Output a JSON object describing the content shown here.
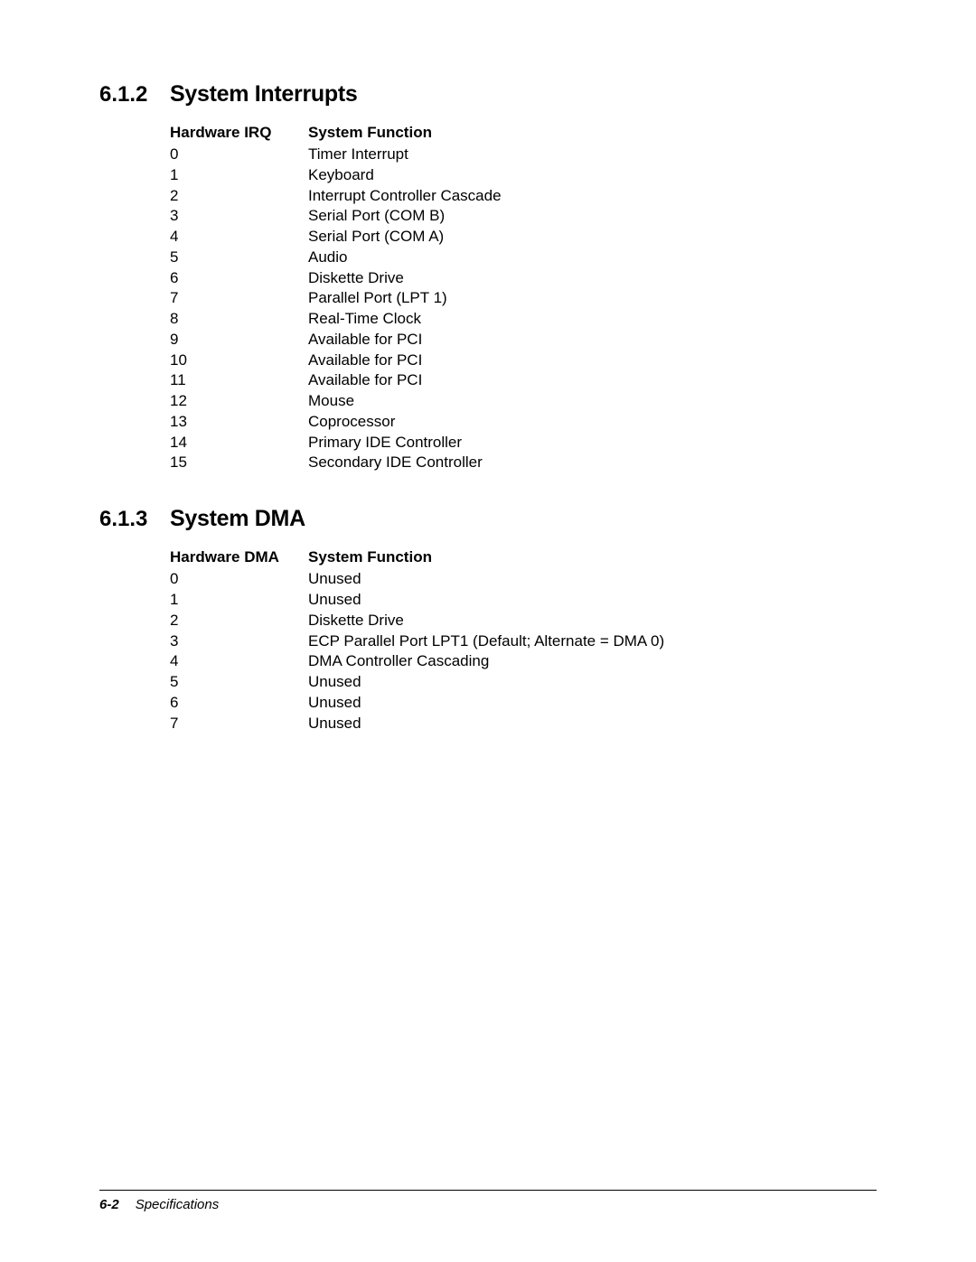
{
  "sections": [
    {
      "number": "6.1.2",
      "title": "System Interrupts",
      "header_col1": "Hardware IRQ",
      "header_col2": "System Function",
      "rows": [
        {
          "c1": "0",
          "c2": "Timer Interrupt"
        },
        {
          "c1": "1",
          "c2": "Keyboard"
        },
        {
          "c1": "2",
          "c2": "Interrupt Controller Cascade"
        },
        {
          "c1": "3",
          "c2": "Serial Port (COM B)"
        },
        {
          "c1": "4",
          "c2": "Serial Port (COM A)"
        },
        {
          "c1": "5",
          "c2": "Audio"
        },
        {
          "c1": "6",
          "c2": "Diskette Drive"
        },
        {
          "c1": "7",
          "c2": "Parallel Port (LPT 1)"
        },
        {
          "c1": "8",
          "c2": "Real-Time Clock"
        },
        {
          "c1": "9",
          "c2": "Available for PCI"
        },
        {
          "c1": "10",
          "c2": "Available for PCI"
        },
        {
          "c1": "11",
          "c2": "Available for PCI"
        },
        {
          "c1": "12",
          "c2": "Mouse"
        },
        {
          "c1": "13",
          "c2": "Coprocessor"
        },
        {
          "c1": "14",
          "c2": "Primary IDE Controller"
        },
        {
          "c1": "15",
          "c2": "Secondary IDE Controller"
        }
      ]
    },
    {
      "number": "6.1.3",
      "title": "System DMA",
      "header_col1": "Hardware DMA",
      "header_col2": "System Function",
      "rows": [
        {
          "c1": "0",
          "c2": "Unused"
        },
        {
          "c1": "1",
          "c2": "Unused"
        },
        {
          "c1": "2",
          "c2": "Diskette Drive"
        },
        {
          "c1": "3",
          "c2": "ECP Parallel Port LPT1 (Default; Alternate = DMA 0)"
        },
        {
          "c1": "4",
          "c2": "DMA Controller Cascading"
        },
        {
          "c1": "5",
          "c2": "Unused"
        },
        {
          "c1": "6",
          "c2": "Unused"
        },
        {
          "c1": "7",
          "c2": "Unused"
        }
      ]
    }
  ],
  "footer": {
    "page_number": "6-2",
    "chapter_title": "Specifications"
  }
}
